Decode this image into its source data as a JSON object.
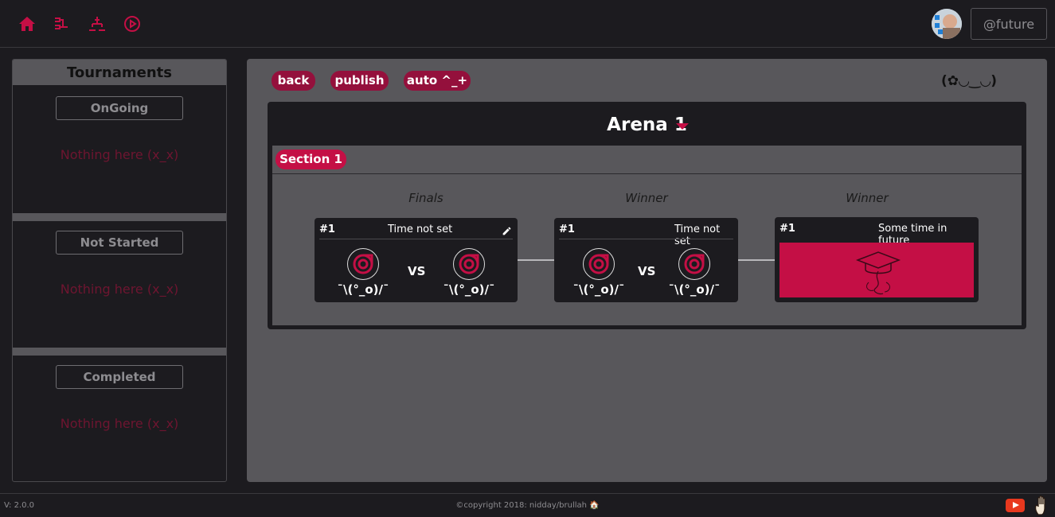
{
  "nav": {
    "icons": [
      "home-icon",
      "bracket-icon",
      "tree-icon",
      "play-icon"
    ],
    "user_handle": "@future"
  },
  "colors": {
    "accent": "#c40f45",
    "dark_accent": "#94103c",
    "panel": "#58575b",
    "background": "#1c1b1f"
  },
  "sidebar": {
    "title": "Tournaments",
    "sections": [
      {
        "label": "OnGoing",
        "empty_text": "Nothing here (x_x)"
      },
      {
        "label": "Not Started",
        "empty_text": "Nothing here (x_x)"
      },
      {
        "label": "Completed",
        "empty_text": "Nothing here (x_x)"
      }
    ]
  },
  "toolbar": {
    "back_label": "back",
    "publish_label": "publish",
    "auto_label": "auto ^_+",
    "kaomoji": "(✿◡‿◡)"
  },
  "arena": {
    "title": "Arena 1",
    "section_label": "Section 1",
    "rounds": [
      "Finals",
      "Winner",
      "Winner"
    ],
    "matches": [
      {
        "number": "#1",
        "time": "Time not set",
        "player1": "¯\\(°_o)/¯",
        "player2": "¯\\(°_o)/¯",
        "vs": "VS"
      },
      {
        "number": "#1",
        "time": "Time not set",
        "player1": "¯\\(°_o)/¯",
        "player2": "¯\\(°_o)/¯",
        "vs": "VS"
      },
      {
        "number": "#1",
        "time": "Some time in future"
      }
    ]
  },
  "footer": {
    "version": "V: 2.0.0",
    "copyright": "©copyright 2018: nidday/brullah 🏠"
  }
}
